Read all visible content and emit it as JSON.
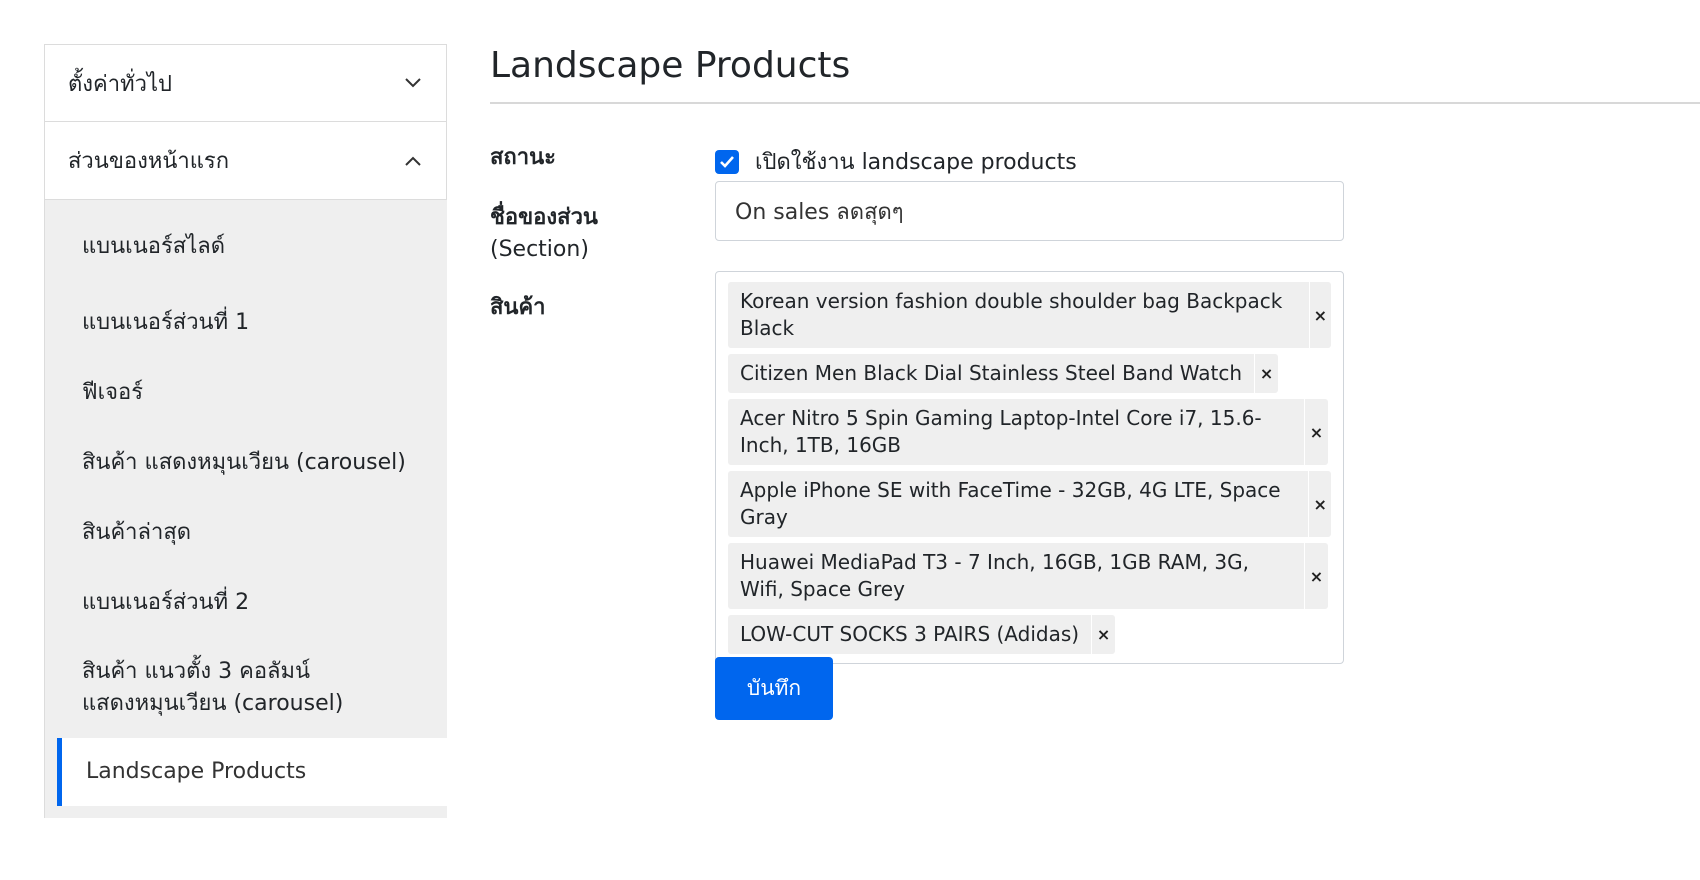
{
  "sidebar": {
    "sections": [
      {
        "label": "ตั้งค่าทั่วไป"
      },
      {
        "label": "ส่วนของหน้าแรก"
      }
    ],
    "items": [
      {
        "label": "แบนเนอร์สไลด์"
      },
      {
        "label": "แบนเนอร์ส่วนที่ 1"
      },
      {
        "label": "ฟีเจอร์"
      },
      {
        "label": "สินค้า แสดงหมุนเวียน (carousel)"
      },
      {
        "label": "สินค้าล่าสุด"
      },
      {
        "label": "แบนเนอร์ส่วนที่ 2"
      },
      {
        "label": "สินค้า แนวตั้ง 3 คอลัมน์ แสดงหมุนเวียน (carousel)"
      },
      {
        "label": "Landscape Products"
      }
    ]
  },
  "main": {
    "title": "Landscape Products",
    "status": {
      "label": "สถานะ",
      "checkbox_label": "เปิดใช้งาน landscape products"
    },
    "section_name": {
      "label": "ชื่อของส่วน",
      "label_sub": "(Section)",
      "value": "On sales ลดสุดๆ"
    },
    "products": {
      "label": "สินค้า",
      "tags": [
        "Korean version fashion double shoulder bag Backpack Black",
        "Citizen Men Black Dial Stainless Steel Band Watch",
        "Acer Nitro 5 Spin Gaming Laptop-Intel Core i7, 15.6-Inch, 1TB, 16GB",
        "Apple iPhone SE with FaceTime - 32GB, 4G LTE, Space Gray",
        "Huawei MediaPad T3 - 7 Inch, 16GB, 1GB RAM, 3G, Wifi, Space Grey",
        "LOW-CUT SOCKS 3 PAIRS (Adidas)"
      ],
      "remove_symbol": "×"
    },
    "save_label": "บันทึก"
  },
  "colors": {
    "accent": "#0066ee",
    "sidebar_bg": "#efefef",
    "tag_bg": "#efefef",
    "border": "#cfd4da"
  }
}
